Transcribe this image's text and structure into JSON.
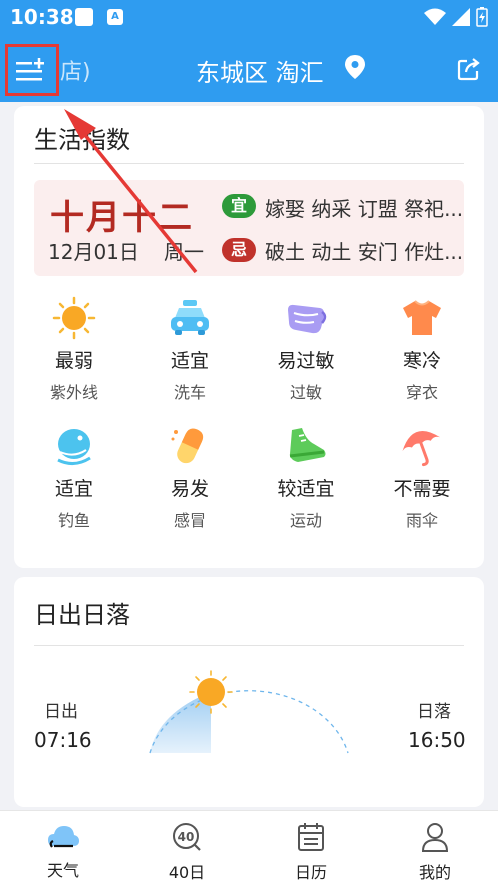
{
  "status": {
    "time": "10:38",
    "app_badge": "A"
  },
  "header": {
    "prev_location": "店)",
    "location": "东城区 淘汇"
  },
  "life_index": {
    "title": "生活指数",
    "lunar_date": "十月十二",
    "date": "12月01日",
    "weekday": "周一",
    "yi_label": "宜",
    "yi_text": "嫁娶 纳采 订盟 祭祀...",
    "ji_label": "忌",
    "ji_text": "破土 动土 安门 作灶...",
    "items": [
      {
        "value": "最弱",
        "label": "紫外线",
        "icon": "sun-icon"
      },
      {
        "value": "适宜",
        "label": "洗车",
        "icon": "car-icon"
      },
      {
        "value": "易过敏",
        "label": "过敏",
        "icon": "mask-icon"
      },
      {
        "value": "寒冷",
        "label": "穿衣",
        "icon": "shirt-icon"
      },
      {
        "value": "适宜",
        "label": "钓鱼",
        "icon": "fish-icon"
      },
      {
        "value": "易发",
        "label": "感冒",
        "icon": "pill-icon"
      },
      {
        "value": "较适宜",
        "label": "运动",
        "icon": "shoe-icon"
      },
      {
        "value": "不需要",
        "label": "雨伞",
        "icon": "umbrella-icon"
      }
    ]
  },
  "sun": {
    "title": "日出日落",
    "sunrise_label": "日出",
    "sunrise_time": "07:16",
    "sunset_label": "日落",
    "sunset_time": "16:50"
  },
  "nav": [
    {
      "label": "天气",
      "icon": "weather-icon"
    },
    {
      "label": "40日",
      "icon": "forty-day-icon"
    },
    {
      "label": "日历",
      "icon": "calendar-icon"
    },
    {
      "label": "我的",
      "icon": "profile-icon"
    }
  ],
  "colors": {
    "primary": "#2f9cf0",
    "lunar_red": "#b32a22",
    "yi_green": "#2d9a3a",
    "ji_red": "#c0322b",
    "highlight": "#e53935"
  }
}
